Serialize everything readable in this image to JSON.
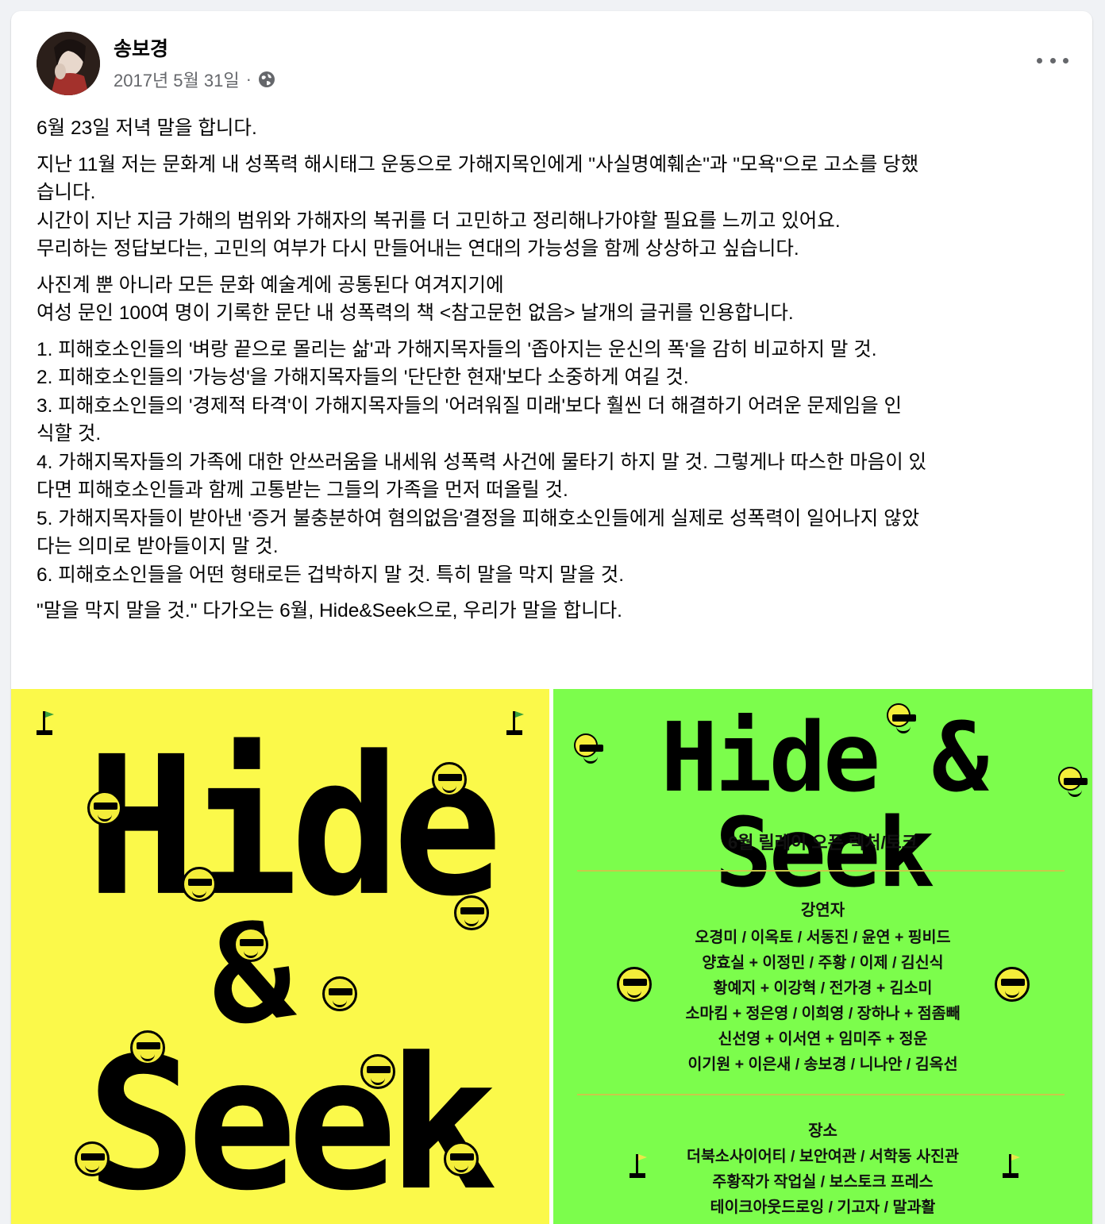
{
  "post": {
    "author": "송보경",
    "date": "2017년 5월 31일",
    "separator": "·",
    "privacy_icon": "globe-icon",
    "more_icon": "more-options-icon",
    "paragraphs": [
      [
        "6월 23일 저녁 말을 합니다."
      ],
      [
        "지난 11월 저는 문화계 내 성폭력 해시태그 운동으로 가해지목인에게 \"사실명예훼손\"과 \"모욕\"으로 고소를 당했",
        "습니다.",
        "시간이 지난 지금 가해의 범위와 가해자의 복귀를 더 고민하고 정리해나가야할 필요를 느끼고 있어요.",
        "무리하는 정답보다는, 고민의 여부가 다시 만들어내는 연대의 가능성을 함께 상상하고 싶습니다."
      ],
      [
        "사진계 뿐 아니라 모든 문화 예술계에 공통된다 여겨지기에",
        "여성 문인 100여 명이 기록한 문단 내 성폭력의 책 <참고문헌 없음> 날개의 글귀를 인용합니다."
      ],
      [
        "1. 피해호소인들의 '벼랑 끝으로 몰리는 삶'과 가해지목자들의 '좁아지는 운신의 폭'을 감히 비교하지 말 것.",
        "2. 피해호소인들의 '가능성'을 가해지목자들의 '단단한 현재'보다 소중하게 여길 것.",
        "3. 피해호소인들의 '경제적 타격'이 가해지목자들의 '어려워질 미래'보다 훨씬 더 해결하기 어려운 문제임을 인",
        "식할 것.",
        "4. 가해지목자들의 가족에 대한 안쓰러움을 내세워 성폭력 사건에 물타기 하지 말 것. 그렇게나 따스한 마음이 있",
        "다면 피해호소인들과 함께 고통받는 그들의 가족을 먼저 떠올릴 것.",
        "5. 가해지목자들이 받아낸 '증거 불충분하여 혐의없음'결정을 피해호소인들에게 실제로 성폭력이 일어나지 않았",
        "다는 의미로 받아들이지 말 것.",
        "6. 피해호소인들을 어떤 형태로든 겁박하지 말 것. 특히 말을 막지 말을 것."
      ],
      [
        "\"말을 막지 말을 것.\" 다가오는 6월, Hide&Seek으로, 우리가 말을 합니다."
      ]
    ]
  },
  "images": {
    "left": {
      "line1": "Hide",
      "amp": "&",
      "line2": "Seek",
      "bg_color": "#fbf94a"
    },
    "right": {
      "title": "Hide & Seek",
      "subtitle": "6월 릴레이 오픈 렉처/토크",
      "speakers_heading": "강연자",
      "speakers": [
        "오경미 / 이옥토 / 서동진 / 윤연 + 핑비드",
        "양효실 + 이정민 / 주황 / 이제 / 김신식",
        "황예지 + 이강혁 / 전가경 + 김소미",
        "소마킴 + 정은영 / 이희영 / 장하나 + 점좀빼",
        "신선영 + 이서연 + 임미주 + 정운",
        "이기원 + 이은새 / 송보경 / 니나안 / 김옥선"
      ],
      "venues_heading": "장소",
      "venues": [
        "더북소사이어티 / 보안여관 / 서학동 사진관",
        "주황작가 작업실 / 보스토크 프레스",
        "테이크아웃드로잉 / 기고자 / 말과활"
      ],
      "bg_color": "#7cfd4c"
    }
  }
}
